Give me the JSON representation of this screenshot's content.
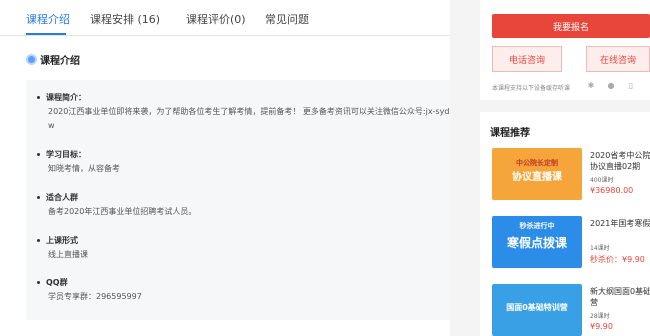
{
  "tabs": [
    {
      "label": "课程介绍",
      "active": true
    },
    {
      "label": "课程安排 (16)",
      "active": false
    },
    {
      "label": "课程评价(0)",
      "active": false
    },
    {
      "label": "常见问题",
      "active": false
    }
  ],
  "section_title": "课程介绍",
  "intro": {
    "items": [
      {
        "heading": "课程简介：",
        "lines": [
          "2020江西事业单位即将来袭，为了帮助各位考生了解考情，提前备考！ 更多备考资讯可以关注微信公众号:jx-syd",
          "w"
        ]
      },
      {
        "heading": "学习目标：",
        "lines": [
          "知晓考情，从容备考"
        ]
      },
      {
        "heading": "适合人群",
        "lines": [
          "备考2020年江西事业单位招聘考试人员。"
        ]
      },
      {
        "heading": "上课形式",
        "lines": [
          "线上直播课"
        ]
      },
      {
        "heading": "QQ群",
        "lines": [
          "学员专享群：296595997"
        ]
      }
    ]
  },
  "sidebar": {
    "enroll_label": "我要报名",
    "phone_label": "电话咨询",
    "online_label": "在线咨询",
    "support_text": "本课程支持以下设备缓存听课",
    "device_icons": [
      "android-icon",
      "apple-icon",
      "tablet-icon"
    ],
    "recommend_title": "课程推荐",
    "courses": [
      {
        "title_line1": "2020省考中公院长",
        "title_line2": "协议直播02期",
        "hours": "400课时",
        "price": "¥36980.00",
        "thumb_text": "中公院长定制",
        "thumb_sub": "协议直播课",
        "thumb_color": "#f5a53a"
      },
      {
        "title_line1": "2021年国考寒假点",
        "title_line2": "",
        "hours": "14课时",
        "price": "秒杀价：¥9.90",
        "thumb_text": "秒杀进行中",
        "thumb_sub": "寒假点拨课",
        "thumb_color": "#2b8de8"
      },
      {
        "title_line1": "新大纲国面0基础特",
        "title_line2": "营",
        "hours": "28课时",
        "price": "¥9.90",
        "thumb_text": "国面0基础特训营",
        "thumb_sub": "",
        "thumb_color": "#3aa0e6"
      }
    ]
  },
  "colors": {
    "accent": "#2a7ae4",
    "brand_red": "#e8463b"
  }
}
